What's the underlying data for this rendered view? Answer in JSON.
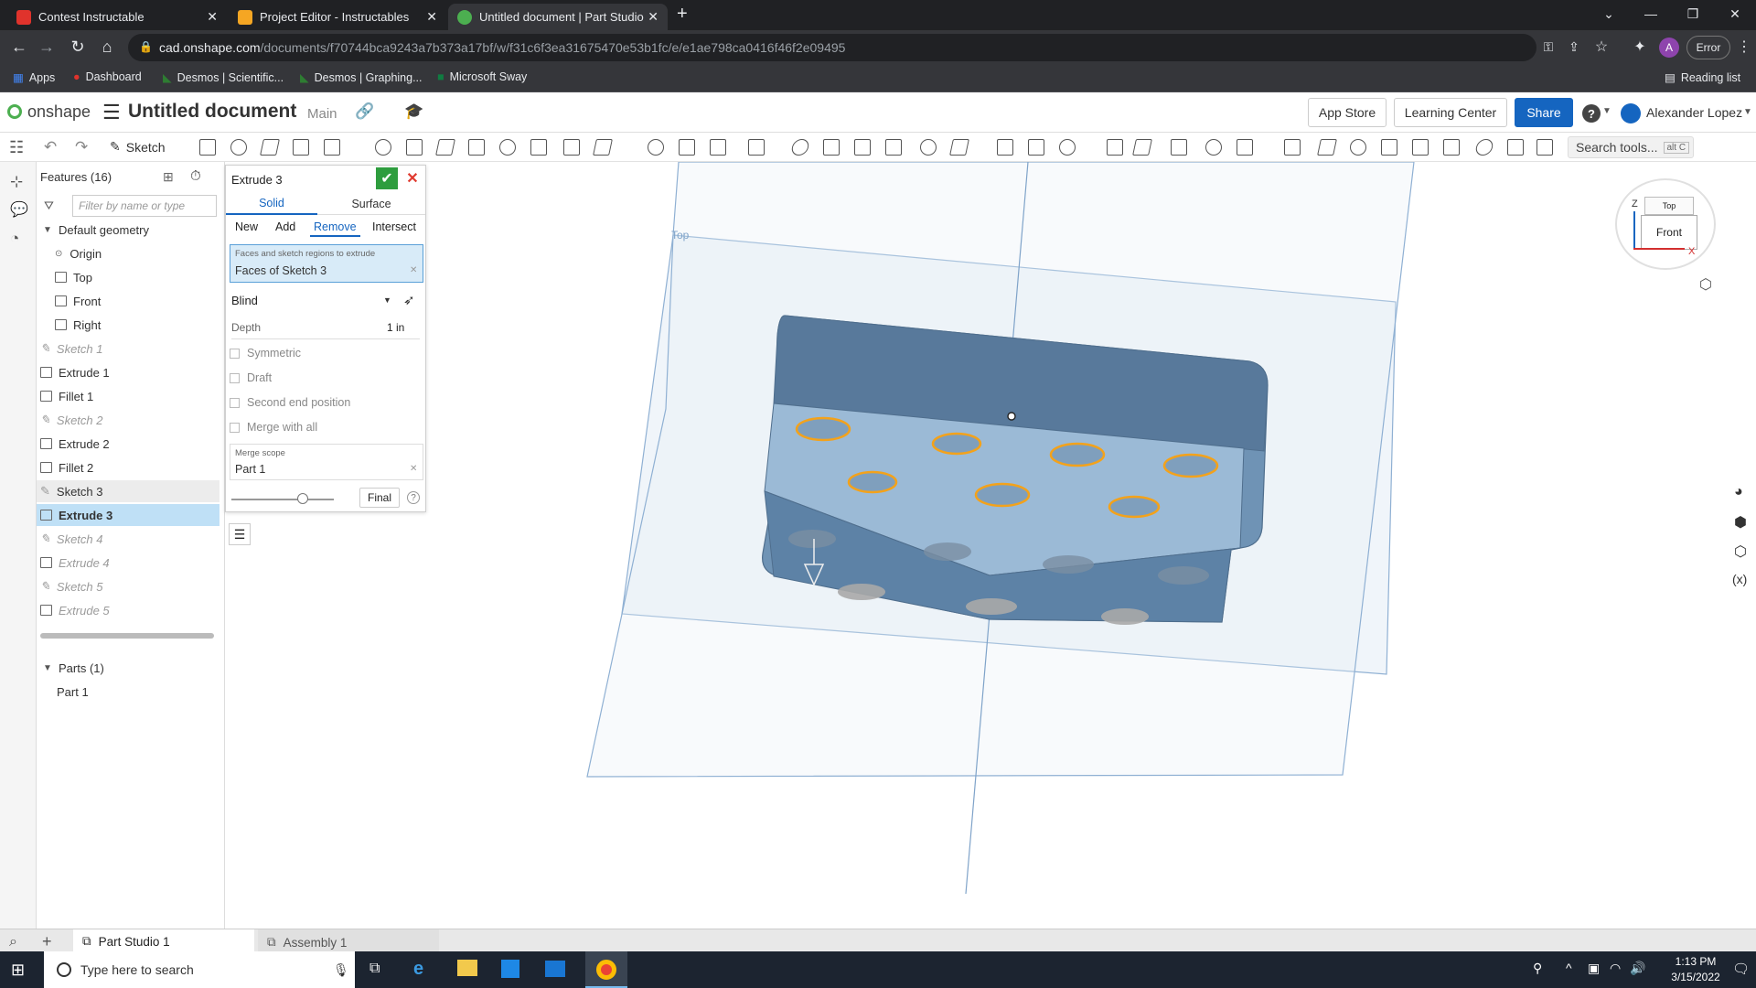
{
  "browser": {
    "tabs": [
      {
        "title": "Contest Instructable",
        "icon_color": "#e0332c",
        "active": false
      },
      {
        "title": "Project Editor - Instructables",
        "icon_color": "#f5a623",
        "active": false
      },
      {
        "title": "Untitled document | Part Studio 1",
        "icon_color": "#4caf50",
        "active": true
      }
    ],
    "new_tab": "+",
    "url_host": "cad.onshape.com",
    "url_path": "/documents/f70744bca9243a7b373a17bf/w/f31c6f3ea31675470e53b1fc/e/e1ae798ca0416f46f2e09495",
    "profile_initial": "A",
    "error_label": "Error",
    "bookmarks": [
      "Apps",
      "Dashboard",
      "Desmos | Scientific...",
      "Desmos | Graphing...",
      "Microsoft Sway"
    ],
    "reading_list": "Reading list"
  },
  "onshape": {
    "logo_text": "onshape",
    "doc_title": "Untitled document",
    "branch": "Main",
    "app_store": "App Store",
    "learning_center": "Learning Center",
    "share": "Share",
    "help": "?",
    "user": "Alexander Lopez",
    "sketch_label": "Sketch",
    "search_tools": "Search tools...",
    "search_shortcut": "alt C",
    "accent": "#1565c0"
  },
  "tree": {
    "header": "Features (16)",
    "filter_placeholder": "Filter by name or type",
    "default_geometry": "Default geometry",
    "items": [
      {
        "label": "Origin",
        "icon": "origin",
        "style": "normal",
        "indent": 2
      },
      {
        "label": "Top",
        "icon": "plane",
        "style": "normal",
        "indent": 2
      },
      {
        "label": "Front",
        "icon": "plane",
        "style": "normal",
        "indent": 2
      },
      {
        "label": "Right",
        "icon": "plane",
        "style": "normal",
        "indent": 2
      },
      {
        "label": "Sketch 1",
        "icon": "sketch",
        "style": "dim",
        "indent": 1
      },
      {
        "label": "Extrude 1",
        "icon": "extrude",
        "style": "normal",
        "indent": 1
      },
      {
        "label": "Fillet 1",
        "icon": "fillet",
        "style": "normal",
        "indent": 1
      },
      {
        "label": "Sketch 2",
        "icon": "sketch",
        "style": "dim",
        "indent": 1
      },
      {
        "label": "Extrude 2",
        "icon": "extrude",
        "style": "normal",
        "indent": 1
      },
      {
        "label": "Fillet 2",
        "icon": "fillet",
        "style": "normal",
        "indent": 1
      },
      {
        "label": "Sketch 3",
        "icon": "sketch",
        "style": "hl",
        "indent": 1
      },
      {
        "label": "Extrude 3",
        "icon": "extrude",
        "style": "sel",
        "indent": 1
      },
      {
        "label": "Sketch 4",
        "icon": "sketch",
        "style": "dim",
        "indent": 1
      },
      {
        "label": "Extrude 4",
        "icon": "extrude",
        "style": "dim",
        "indent": 1
      },
      {
        "label": "Sketch 5",
        "icon": "sketch",
        "style": "dim",
        "indent": 1
      },
      {
        "label": "Extrude 5",
        "icon": "extrude",
        "style": "dim",
        "indent": 1
      }
    ],
    "parts_header": "Parts (1)",
    "parts": [
      "Part 1"
    ]
  },
  "extrude": {
    "title": "Extrude 3",
    "tabs": [
      "Solid",
      "Surface"
    ],
    "modes": [
      "New",
      "Add",
      "Remove",
      "Intersect"
    ],
    "active_mode": "Remove",
    "faces_label": "Faces and sketch regions to extrude",
    "faces_value": "Faces of Sketch 3",
    "end_type": "Blind",
    "depth_label": "Depth",
    "depth_value": "1 in",
    "options": [
      "Symmetric",
      "Draft",
      "Second end position",
      "Merge with all"
    ],
    "merge_scope_label": "Merge scope",
    "merge_scope_value": "Part 1",
    "final_label": "Final",
    "help": "?"
  },
  "viewport": {
    "plane_label": "Top",
    "viewcube_front": "Front",
    "viewcube_top": "Top",
    "axis_z": "Z",
    "axis_x": "X"
  },
  "bottom_tabs": [
    "Part Studio 1",
    "Assembly 1"
  ],
  "taskbar": {
    "search_placeholder": "Type here to search",
    "time": "1:13 PM",
    "date": "3/15/2022"
  }
}
